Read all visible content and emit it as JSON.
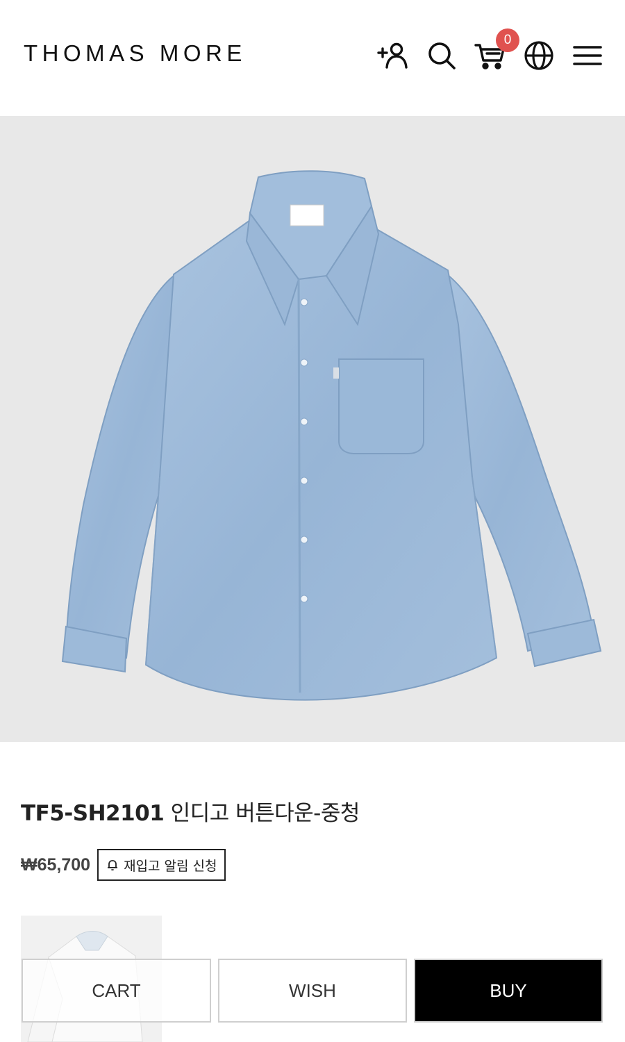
{
  "header": {
    "logo": "THOMAS MORE",
    "icons": [
      "add-user-icon",
      "search-icon",
      "cart-icon",
      "globe-icon",
      "menu-icon"
    ],
    "cart_count": "0",
    "badge_color": "#e0524f"
  },
  "product": {
    "code": "TF5-SH2101",
    "name": "인디고 버튼다운-중청",
    "price": "₩65,700",
    "restock_label": "재입고 알림 신청",
    "image_bg": "#e8e8e8",
    "shirt_color": "#9bb9d9"
  },
  "actions": {
    "cart_label": "CART",
    "wish_label": "WISH",
    "buy_label": "BUY"
  }
}
